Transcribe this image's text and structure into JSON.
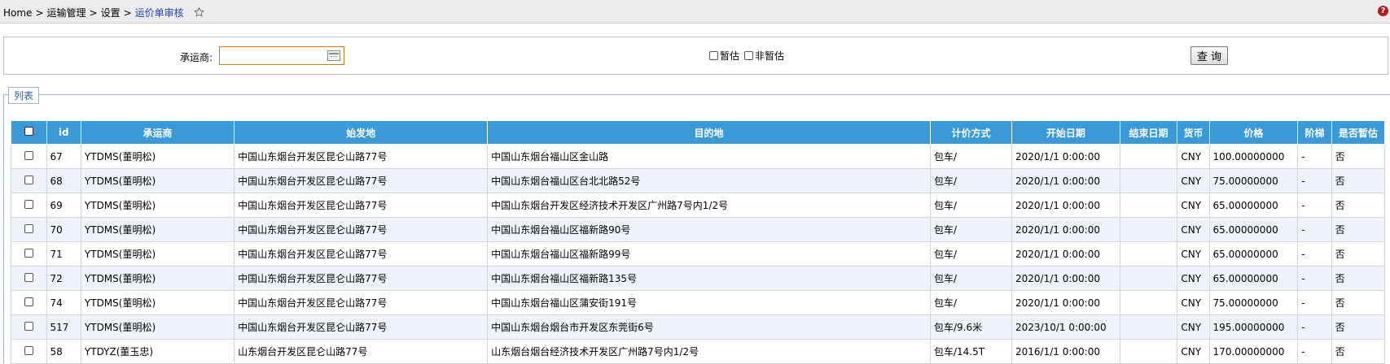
{
  "breadcrumb": {
    "items": [
      "Home",
      "运输管理",
      "设置"
    ],
    "current": "运价单审核",
    "separator": ">"
  },
  "icons": {
    "favorite": "star-outline-icon",
    "help": "help-circle-icon",
    "calendar": "calendar-icon"
  },
  "help_label": "?",
  "filter": {
    "carrier_label": "承运商:",
    "carrier_value": "",
    "options": [
      {
        "label": "暂估",
        "checked": false
      },
      {
        "label": "非暂估",
        "checked": false
      }
    ],
    "query_button": "查 询"
  },
  "list": {
    "legend": "列表",
    "columns": [
      "id",
      "承运商",
      "始发地",
      "目的地",
      "计价方式",
      "开始日期",
      "结束日期",
      "货币",
      "价格",
      "阶梯",
      "是否暂估"
    ],
    "rows": [
      {
        "id": "67",
        "carrier": "YTDMS(董明松)",
        "origin": "中国山东烟台开发区昆仑山路77号",
        "dest": "中国山东烟台福山区金山路",
        "pricing": "包车/",
        "start": "2020/1/1 0:00:00",
        "end": "",
        "currency": "CNY",
        "price": "100.00000000",
        "tier": "-",
        "estimate": "否"
      },
      {
        "id": "68",
        "carrier": "YTDMS(董明松)",
        "origin": "中国山东烟台开发区昆仑山路77号",
        "dest": "中国山东烟台福山区台北北路52号",
        "pricing": "包车/",
        "start": "2020/1/1 0:00:00",
        "end": "",
        "currency": "CNY",
        "price": "75.00000000",
        "tier": "-",
        "estimate": "否"
      },
      {
        "id": "69",
        "carrier": "YTDMS(董明松)",
        "origin": "中国山东烟台开发区昆仑山路77号",
        "dest": "中国山东烟台开发区经济技术开发区广州路7号内1/2号",
        "pricing": "包车/",
        "start": "2020/1/1 0:00:00",
        "end": "",
        "currency": "CNY",
        "price": "65.00000000",
        "tier": "-",
        "estimate": "否"
      },
      {
        "id": "70",
        "carrier": "YTDMS(董明松)",
        "origin": "中国山东烟台开发区昆仑山路77号",
        "dest": "中国山东烟台福山区福新路90号",
        "pricing": "包车/",
        "start": "2020/1/1 0:00:00",
        "end": "",
        "currency": "CNY",
        "price": "65.00000000",
        "tier": "-",
        "estimate": "否"
      },
      {
        "id": "71",
        "carrier": "YTDMS(董明松)",
        "origin": "中国山东烟台开发区昆仑山路77号",
        "dest": "中国山东烟台福山区福新路99号",
        "pricing": "包车/",
        "start": "2020/1/1 0:00:00",
        "end": "",
        "currency": "CNY",
        "price": "65.00000000",
        "tier": "-",
        "estimate": "否"
      },
      {
        "id": "72",
        "carrier": "YTDMS(董明松)",
        "origin": "中国山东烟台开发区昆仑山路77号",
        "dest": "中国山东烟台福山区福新路135号",
        "pricing": "包车/",
        "start": "2020/1/1 0:00:00",
        "end": "",
        "currency": "CNY",
        "price": "65.00000000",
        "tier": "-",
        "estimate": "否"
      },
      {
        "id": "74",
        "carrier": "YTDMS(董明松)",
        "origin": "中国山东烟台开发区昆仑山路77号",
        "dest": "中国山东烟台福山区蒲安街191号",
        "pricing": "包车/",
        "start": "2020/1/1 0:00:00",
        "end": "",
        "currency": "CNY",
        "price": "75.00000000",
        "tier": "-",
        "estimate": "否"
      },
      {
        "id": "517",
        "carrier": "YTDMS(董明松)",
        "origin": "中国山东烟台开发区昆仑山路77号",
        "dest": "中国山东烟台烟台市开发区东莞街6号",
        "pricing": "包车/9.6米",
        "start": "2023/10/1 0:00:00",
        "end": "",
        "currency": "CNY",
        "price": "195.00000000",
        "tier": "-",
        "estimate": "否"
      },
      {
        "id": "58",
        "carrier": "YTDYZ(董玉忠)",
        "origin": "山东烟台开发区昆仑山路77号",
        "dest": "山东烟台烟台经济技术开发区广州路7号内1/2号",
        "pricing": "包车/14.5T",
        "start": "2016/1/1 0:00:00",
        "end": "",
        "currency": "CNY",
        "price": "170.00000000",
        "tier": "-",
        "estimate": "否"
      }
    ]
  }
}
